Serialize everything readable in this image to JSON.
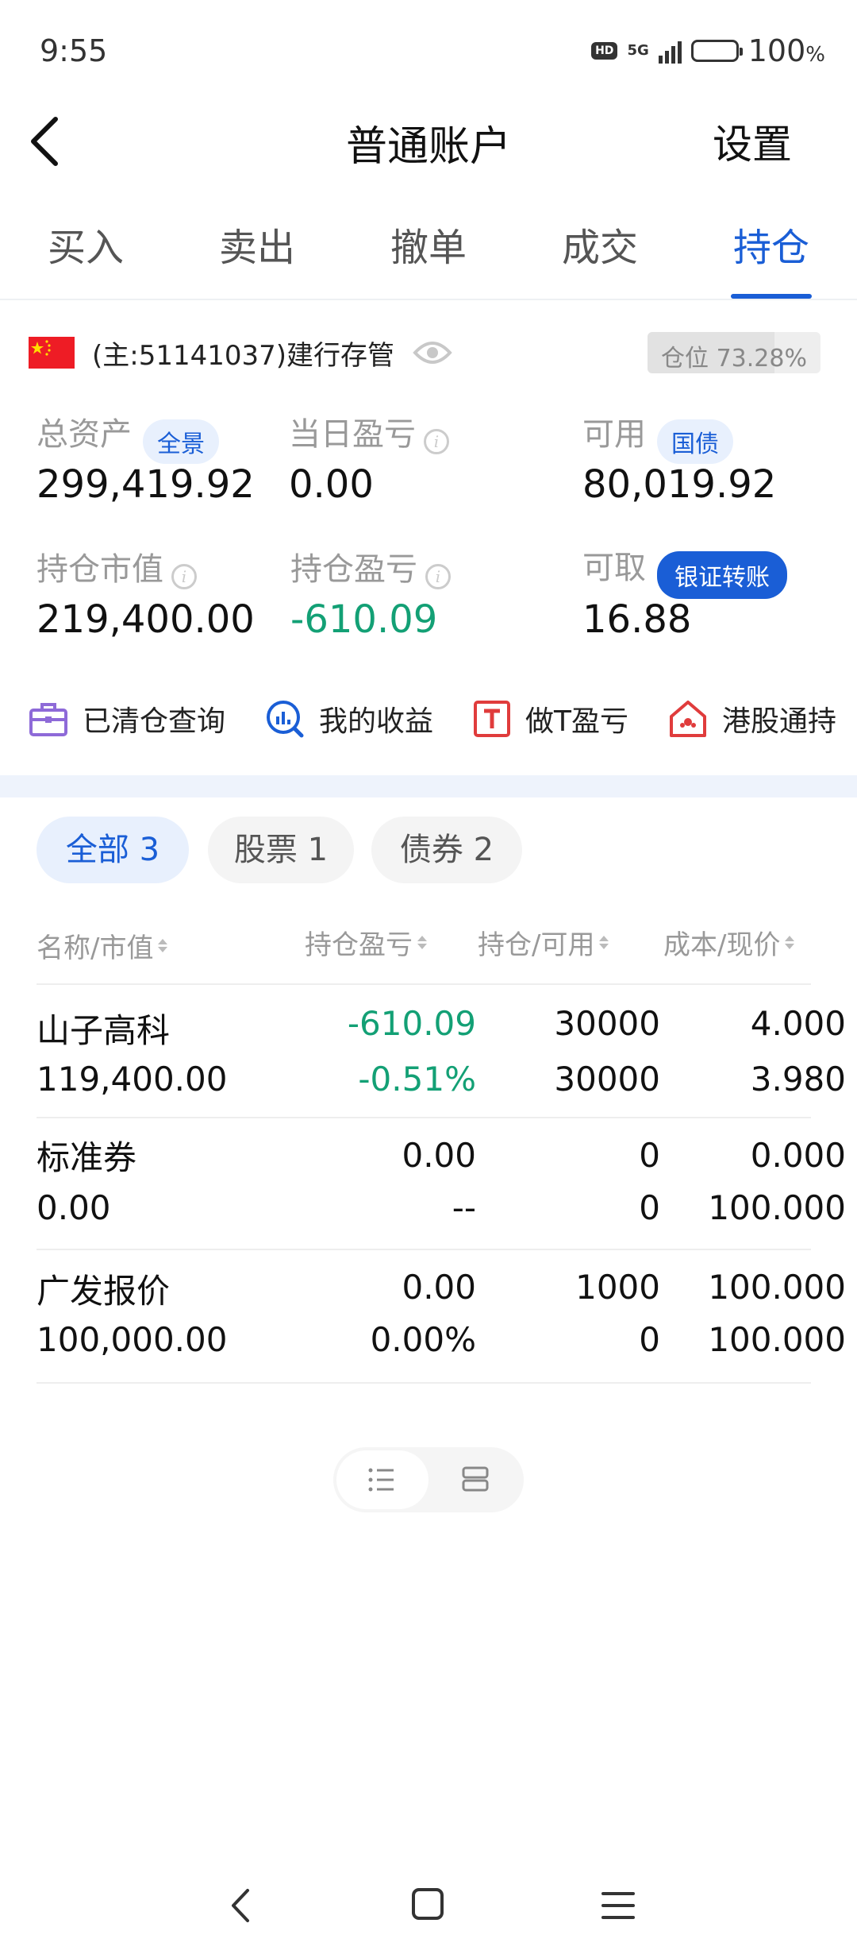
{
  "status_bar": {
    "time": "9:55",
    "hd": "HD",
    "network": "5G",
    "battery": "100",
    "battery_unit": "%",
    "battery_level": 1.0
  },
  "header": {
    "title": "普通账户",
    "settings": "设置",
    "back_icon": "chevron-left-icon"
  },
  "tabs": [
    {
      "label": "买入",
      "active": false
    },
    {
      "label": "卖出",
      "active": false
    },
    {
      "label": "撤单",
      "active": false
    },
    {
      "label": "成交",
      "active": false
    },
    {
      "label": "持仓",
      "active": true
    }
  ],
  "account": {
    "flag_icon": "china-flag-icon",
    "label": "(主:51141037)建行存管",
    "eye_icon": "eye-icon",
    "position_text": "仓位 73.28%",
    "position_ratio": 0.7328
  },
  "assets": {
    "total_label": "总资产",
    "total_tag": "全景",
    "total_value": "299,419.92",
    "daily_pl_label": "当日盈亏",
    "daily_pl_value": "0.00",
    "available_label": "可用",
    "available_tag": "国债",
    "available_value": "80,019.92",
    "market_value_label": "持仓市值",
    "market_value": "219,400.00",
    "position_pl_label": "持仓盈亏",
    "position_pl_value": "-610.09",
    "withdrawable_label": "可取",
    "transfer_button": "银证转账",
    "withdrawable_value": "16.88",
    "info_icon": "info-icon"
  },
  "quick_links": [
    {
      "label": "已清仓查询",
      "icon": "briefcase-icon",
      "color": "#8e6ad8"
    },
    {
      "label": "我的收益",
      "icon": "chart-search-icon",
      "color": "#1a5ed6"
    },
    {
      "label": "做T盈亏",
      "icon": "t-box-icon",
      "color": "#e03c3c"
    },
    {
      "label": "港股通持",
      "icon": "hk-house-icon",
      "color": "#e03c3c"
    }
  ],
  "filters": [
    {
      "label": "全部 3",
      "active": true
    },
    {
      "label": "股票 1",
      "active": false
    },
    {
      "label": "债券 2",
      "active": false
    }
  ],
  "table": {
    "headers": [
      "名称/市值",
      "持仓盈亏",
      "持仓/可用",
      "成本/现价"
    ],
    "rows": [
      {
        "name": "山子高科",
        "market_value": "119,400.00",
        "pl": "-610.09",
        "pl_pct": "-0.51%",
        "holding": "30000",
        "available": "30000",
        "cost": "4.000",
        "price": "3.980",
        "negative": true
      },
      {
        "name": "标准券",
        "market_value": "0.00",
        "pl": "0.00",
        "pl_pct": "--",
        "holding": "0",
        "available": "0",
        "cost": "0.000",
        "price": "100.000",
        "negative": false
      },
      {
        "name": "广发报价",
        "market_value": "100,000.00",
        "pl": "0.00",
        "pl_pct": "0.00%",
        "holding": "1000",
        "available": "0",
        "cost": "100.000",
        "price": "100.000",
        "negative": false
      }
    ]
  },
  "view_toggle": {
    "list_icon": "list-icon",
    "card_icon": "card-view-icon"
  },
  "colors": {
    "accent": "#1a5ed6",
    "loss": "#13a075",
    "muted": "#999999"
  },
  "nav": {
    "back_icon": "nav-back-icon",
    "home_icon": "nav-home-icon",
    "menu_icon": "nav-menu-icon"
  }
}
